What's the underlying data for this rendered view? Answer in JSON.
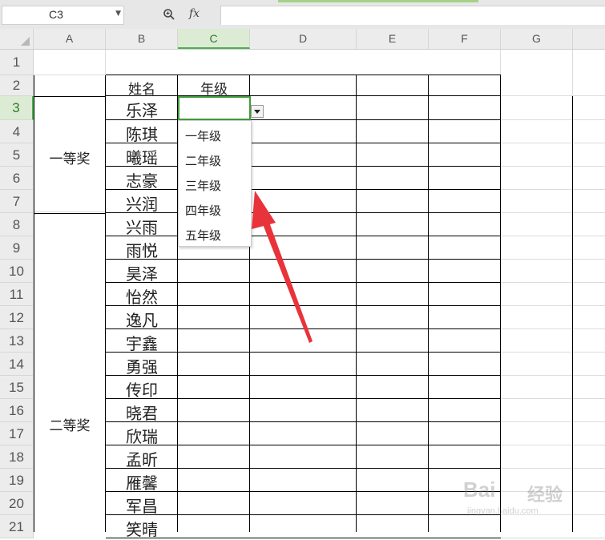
{
  "formula_bar": {
    "name_box": "C3",
    "fx_label": "fx",
    "formula_value": ""
  },
  "columns": [
    "A",
    "B",
    "C",
    "D",
    "E",
    "F",
    "G"
  ],
  "active_column": "C",
  "rows": [
    "1",
    "2",
    "3",
    "4",
    "5",
    "6",
    "7",
    "8",
    "9",
    "10",
    "11",
    "12",
    "13",
    "14",
    "15",
    "16",
    "17",
    "18",
    "19",
    "20",
    "21"
  ],
  "active_row": "3",
  "table": {
    "header_name": "姓名",
    "header_grade": "年级",
    "names": [
      "乐泽",
      "陈琪",
      "曦瑶",
      "志豪",
      "兴润",
      "兴雨",
      "雨悦",
      "昊泽",
      "怡然",
      "逸凡",
      "宇鑫",
      "勇强",
      "传印",
      "晓君",
      "欣瑞",
      "孟昕",
      "雁馨",
      "军昌",
      "笑晴"
    ]
  },
  "awards": {
    "first": "一等奖",
    "second": "二等奖"
  },
  "dropdown": {
    "options": [
      "一年级",
      "二年级",
      "三年级",
      "四年级",
      "五年级"
    ]
  },
  "watermark": {
    "brand": "Bai",
    "brand2": "经验",
    "url": "jingyan.baidu.com"
  },
  "colors": {
    "accent_green": "#4caf50",
    "annotation_arrow": "#e8333a"
  }
}
